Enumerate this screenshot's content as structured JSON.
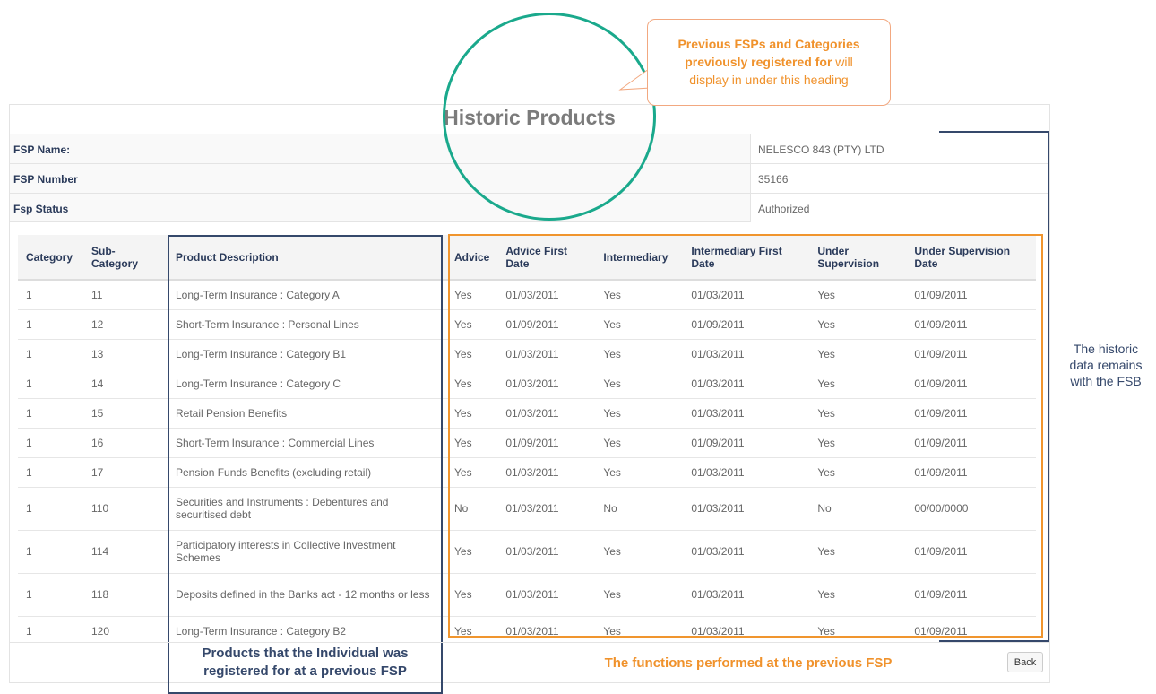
{
  "page": {
    "title": "Historic Products"
  },
  "callout": {
    "line1_bold": "Previous FSPs and Categories",
    "line2_bold": "previously registered for",
    "line2_rest": " will",
    "line3": "display in under this heading"
  },
  "fsp": {
    "name_label": "FSP Name:",
    "name_value": "NELESCO 843 (PTY) LTD",
    "number_label": "FSP Number",
    "number_value": "35166",
    "status_label": "Fsp Status",
    "status_value": "Authorized"
  },
  "table": {
    "headers": [
      "Category",
      "Sub-Category",
      "Product Description",
      "Advice",
      "Advice First Date",
      "Intermediary",
      "Intermediary First Date",
      "Under Supervision",
      "Under Supervision Date"
    ],
    "rows": [
      [
        "1",
        "11",
        "Long-Term Insurance : Category A",
        "Yes",
        "01/03/2011",
        "Yes",
        "01/03/2011",
        "Yes",
        "01/09/2011"
      ],
      [
        "1",
        "12",
        "Short-Term Insurance : Personal Lines",
        "Yes",
        "01/09/2011",
        "Yes",
        "01/09/2011",
        "Yes",
        "01/09/2011"
      ],
      [
        "1",
        "13",
        "Long-Term Insurance : Category B1",
        "Yes",
        "01/03/2011",
        "Yes",
        "01/03/2011",
        "Yes",
        "01/09/2011"
      ],
      [
        "1",
        "14",
        "Long-Term Insurance : Category C",
        "Yes",
        "01/03/2011",
        "Yes",
        "01/03/2011",
        "Yes",
        "01/09/2011"
      ],
      [
        "1",
        "15",
        "Retail Pension Benefits",
        "Yes",
        "01/03/2011",
        "Yes",
        "01/03/2011",
        "Yes",
        "01/09/2011"
      ],
      [
        "1",
        "16",
        "Short-Term Insurance : Commercial Lines",
        "Yes",
        "01/09/2011",
        "Yes",
        "01/09/2011",
        "Yes",
        "01/09/2011"
      ],
      [
        "1",
        "17",
        "Pension Funds Benefits (excluding retail)",
        "Yes",
        "01/03/2011",
        "Yes",
        "01/03/2011",
        "Yes",
        "01/09/2011"
      ],
      [
        "1",
        "110",
        "Securities and Instruments : Debentures and securitised debt",
        "No",
        "01/03/2011",
        "No",
        "01/03/2011",
        "No",
        "00/00/0000"
      ],
      [
        "1",
        "114",
        "Participatory interests in Collective Investment Schemes",
        "Yes",
        "01/03/2011",
        "Yes",
        "01/03/2011",
        "Yes",
        "01/09/2011"
      ],
      [
        "1",
        "118",
        "Deposits defined in the Banks act - 12 months or less",
        "Yes",
        "01/03/2011",
        "Yes",
        "01/03/2011",
        "Yes",
        "01/09/2011"
      ],
      [
        "1",
        "120",
        "Long-Term Insurance : Category B2",
        "Yes",
        "01/03/2011",
        "Yes",
        "01/03/2011",
        "Yes",
        "01/09/2011"
      ]
    ]
  },
  "annotations": {
    "blue_line1": "Products that the Individual was",
    "blue_line2": "registered for at a previous FSP",
    "orange": "The functions performed at the previous FSP",
    "right_line1": "The historic",
    "right_line2": "data remains",
    "right_line3": "with the FSB"
  },
  "buttons": {
    "back": "Back"
  },
  "colors": {
    "navy": "#35486b",
    "orange": "#f0952e",
    "teal": "#1aa98c"
  }
}
